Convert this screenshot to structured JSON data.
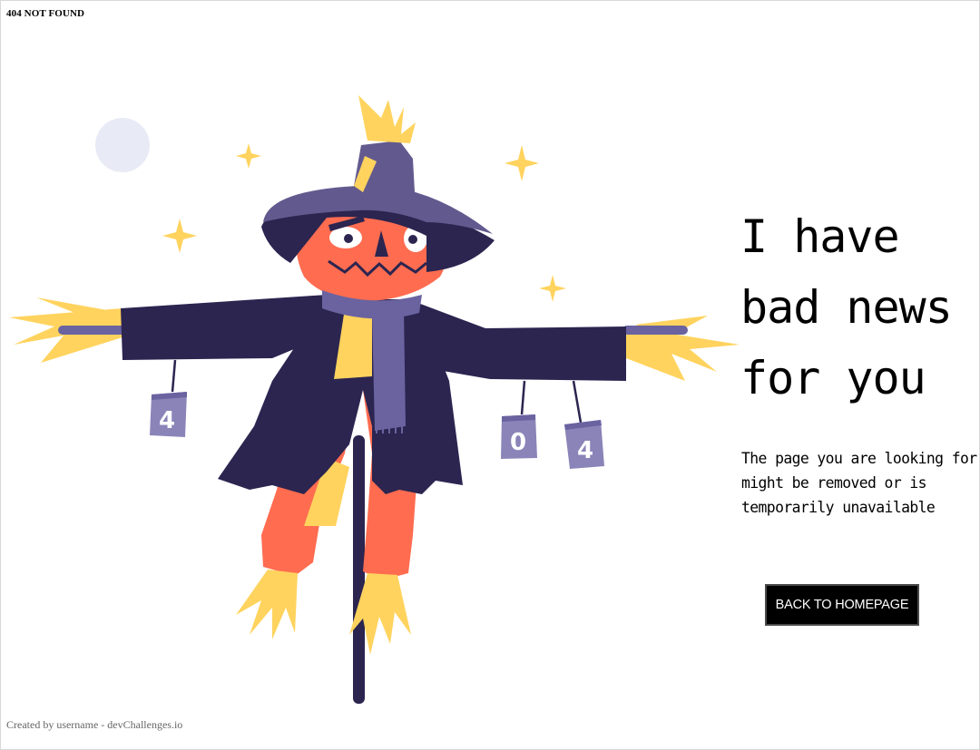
{
  "header": {
    "title": "404 NOT FOUND"
  },
  "main": {
    "heading": "I have bad news for you",
    "description": "The page you are looking for might be removed or is temporarily unavailable",
    "button_label": "BACK TO HOMEPAGE"
  },
  "illustration": {
    "cans": [
      "4",
      "0",
      "4"
    ],
    "colors": {
      "hat": "#625A8E",
      "coat": "#2B2550",
      "face": "#FF6C50",
      "straw": "#FFD35E",
      "scarf": "#6A63A0",
      "moon": "#E8EBF5"
    }
  },
  "footer": {
    "created_by": "Created by username",
    "separator": "-",
    "site": "devChallenges.io"
  }
}
